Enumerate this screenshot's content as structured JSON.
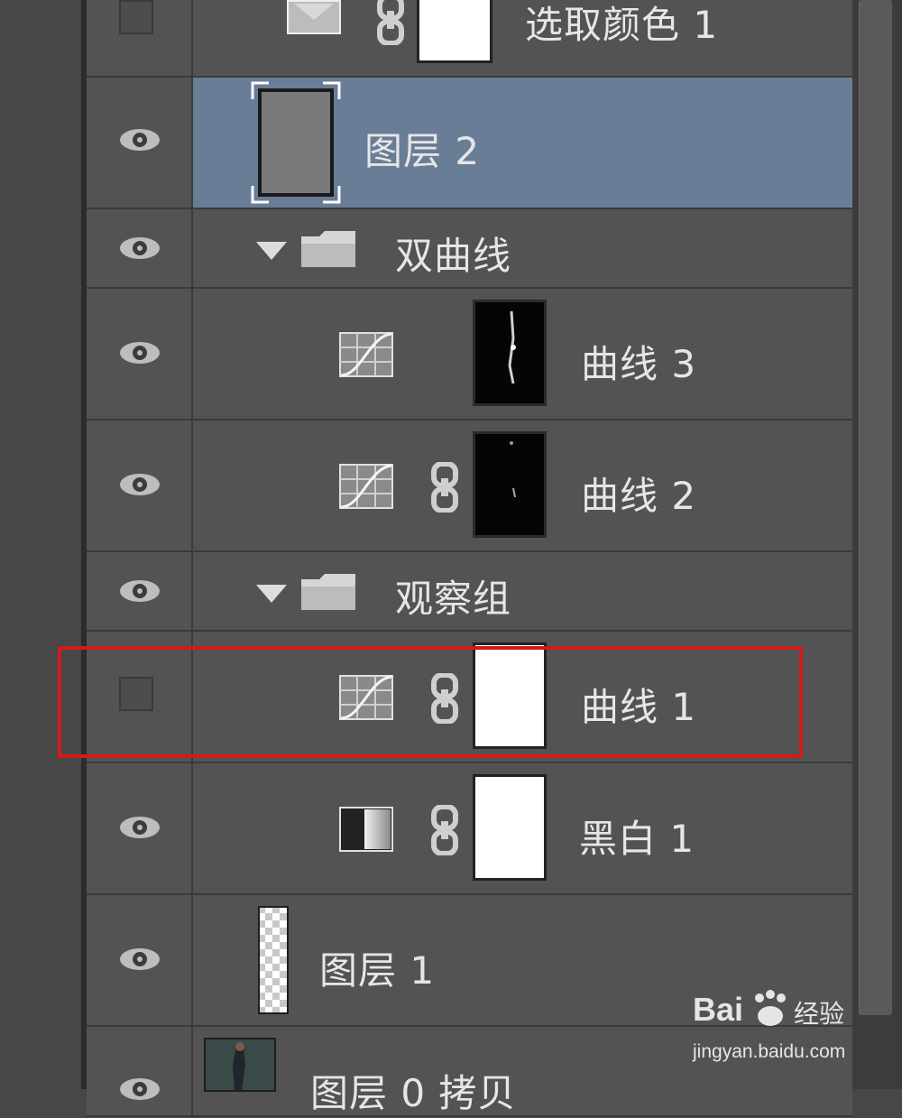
{
  "colors": {
    "panel_bg": "#535353",
    "selected_bg": "#6a7d97",
    "highlight_border": "#d11a1a",
    "text": "#e6e6e6"
  },
  "layers": [
    {
      "name": "选取颜色 1",
      "icon": "selective-color-icon",
      "visible": false,
      "selected": false,
      "kind": "adjustment"
    },
    {
      "name": "图层 2",
      "icon": "layer-thumbnail",
      "visible": true,
      "selected": true,
      "kind": "pixel"
    },
    {
      "name": "双曲线",
      "icon": "folder-icon",
      "visible": true,
      "selected": false,
      "kind": "group",
      "expanded": true
    },
    {
      "name": "曲线 3",
      "icon": "curves-icon",
      "visible": true,
      "selected": false,
      "kind": "adjustment",
      "mask": "black"
    },
    {
      "name": "曲线 2",
      "icon": "curves-icon",
      "visible": true,
      "selected": false,
      "kind": "adjustment",
      "mask": "black"
    },
    {
      "name": "观察组",
      "icon": "folder-icon",
      "visible": true,
      "selected": false,
      "kind": "group",
      "expanded": true
    },
    {
      "name": "曲线 1",
      "icon": "curves-icon",
      "visible": false,
      "selected": false,
      "kind": "adjustment",
      "mask": "white",
      "highlighted": true
    },
    {
      "name": "黑白 1",
      "icon": "black-white-icon",
      "visible": true,
      "selected": false,
      "kind": "adjustment",
      "mask": "white"
    },
    {
      "name": "图层 1",
      "icon": "transparent-layer-thumbnail",
      "visible": true,
      "selected": false,
      "kind": "pixel"
    },
    {
      "name": "图层 0 拷贝",
      "icon": "photo-thumbnail",
      "visible": true,
      "selected": false,
      "kind": "pixel"
    }
  ],
  "watermark": {
    "brand": "Bai",
    "brand2": "经验",
    "url": "jingyan.baidu.com"
  }
}
